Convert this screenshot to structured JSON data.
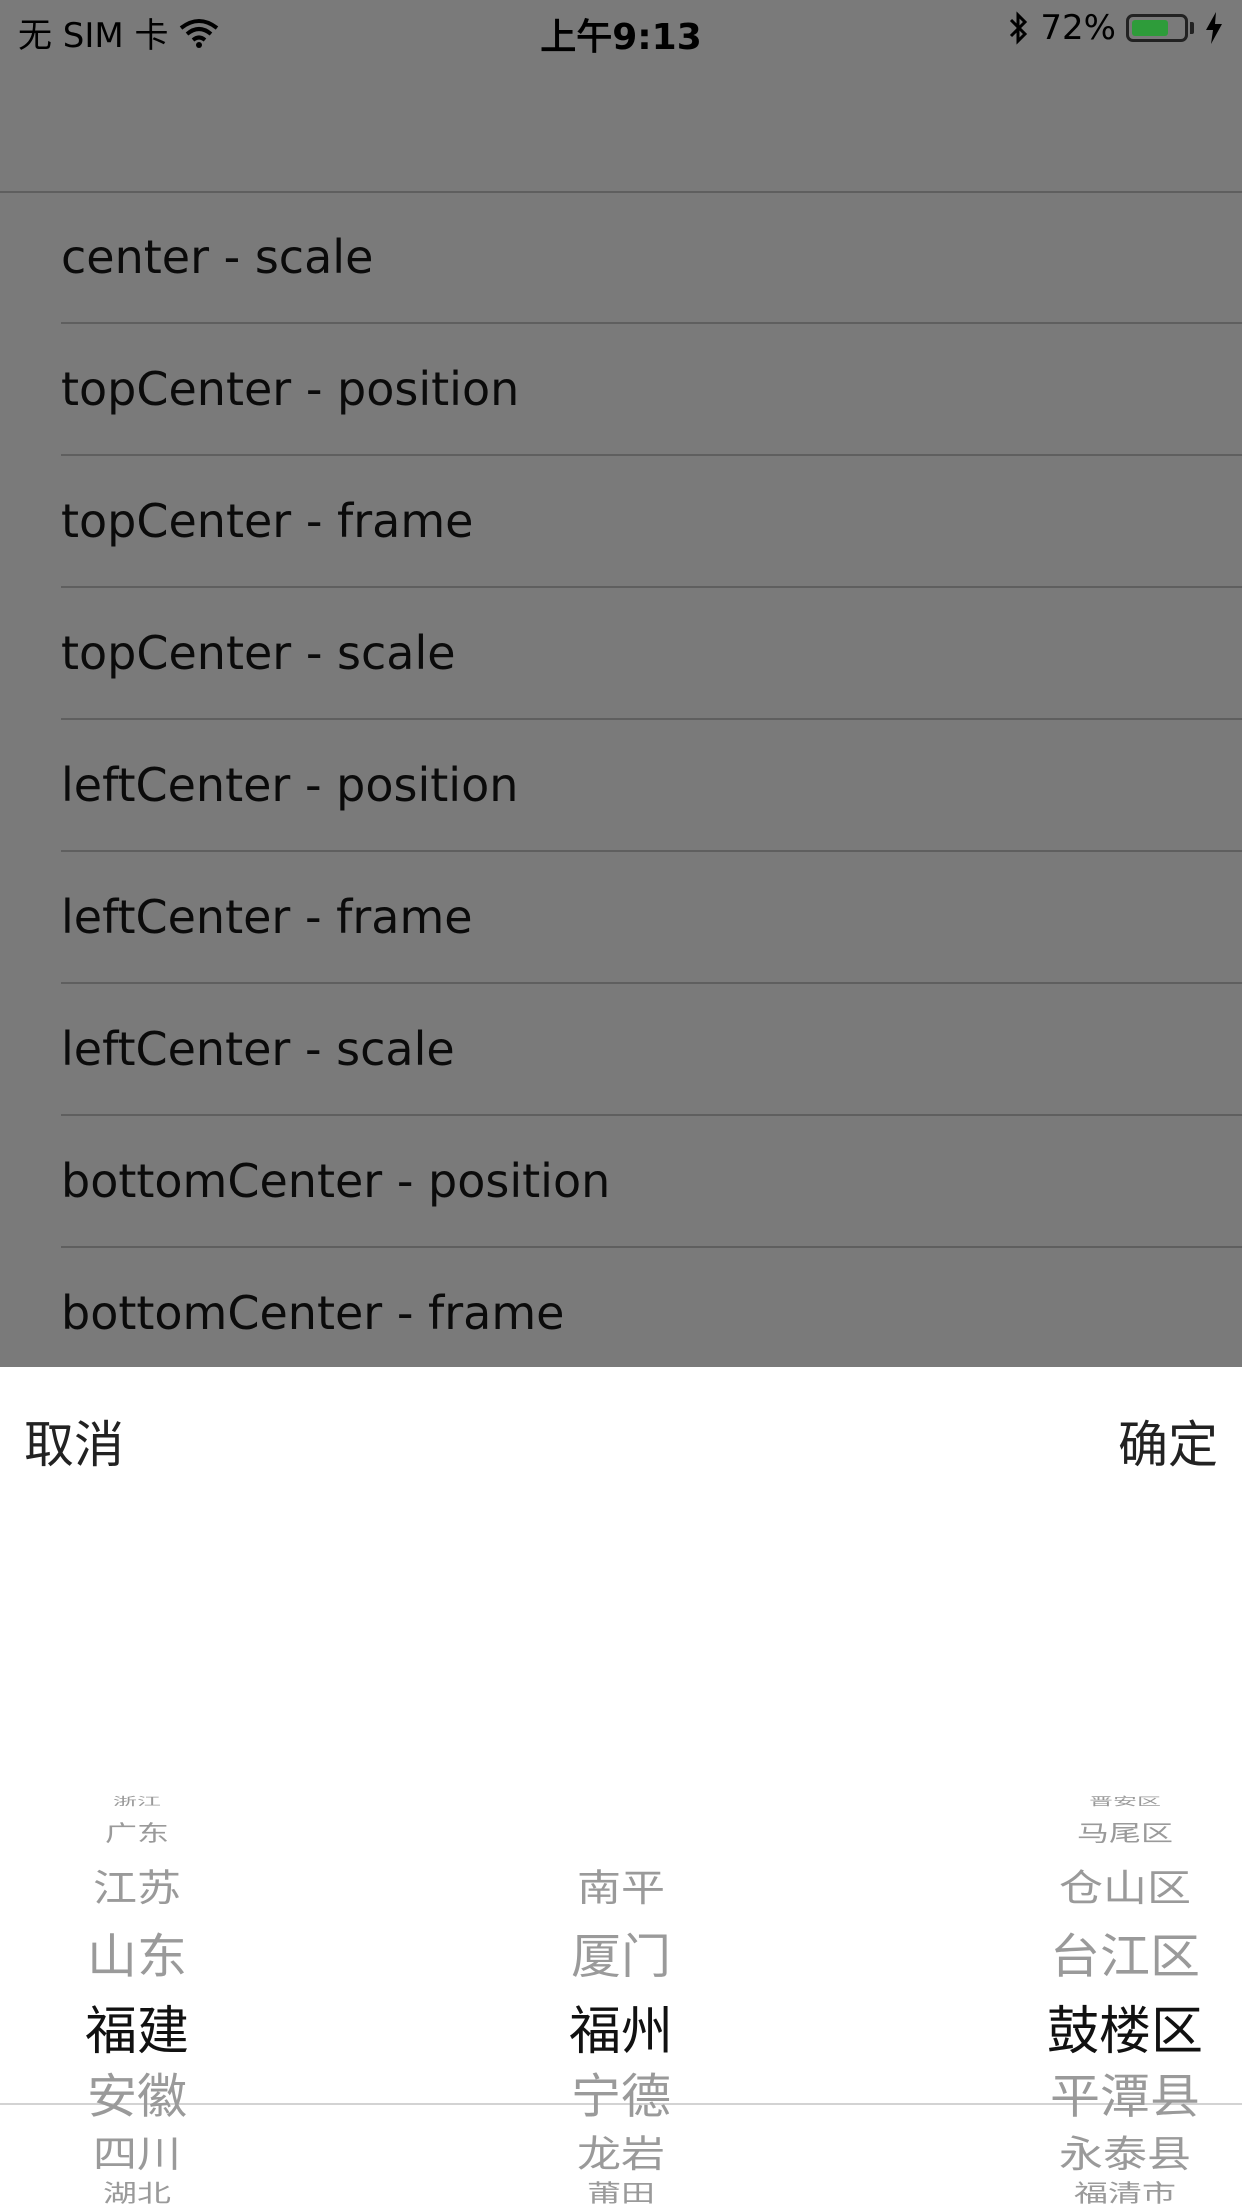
{
  "status_bar": {
    "carrier": "无 SIM 卡",
    "time": "上午9:13",
    "battery": "72%",
    "battery_level": 0.72
  },
  "table": {
    "rows": [
      "center - scale",
      "topCenter - position",
      "topCenter - frame",
      "topCenter - scale",
      "leftCenter - position",
      "leftCenter - frame",
      "leftCenter - scale",
      "bottomCenter - position",
      "bottomCenter - frame"
    ]
  },
  "picker": {
    "cancel_label": "取消",
    "confirm_label": "确定",
    "province": {
      "items": [
        "浙江",
        "广东",
        "江苏",
        "山东",
        "福建",
        "安徽",
        "四川",
        "湖北"
      ],
      "selected": "福建"
    },
    "city": {
      "items": [
        "南平",
        "厦门",
        "福州",
        "宁德",
        "龙岩",
        "莆田"
      ],
      "selected": "福州"
    },
    "district": {
      "items": [
        "晋安区",
        "马尾区",
        "仓山区",
        "台江区",
        "鼓楼区",
        "平潭县",
        "永泰县",
        "福清市"
      ],
      "selected": "鼓楼区"
    },
    "colors": {
      "selected": "#111111",
      "unselected": "#9a9a9a"
    }
  }
}
